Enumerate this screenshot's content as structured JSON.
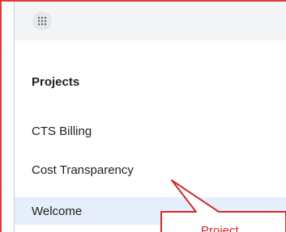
{
  "topbar": {
    "app_launcher_icon": "grid-icon"
  },
  "projects": {
    "heading": "Projects",
    "items": [
      {
        "label": "CTS Billing",
        "active": false
      },
      {
        "label": "Cost Transparency",
        "active": false
      },
      {
        "label": "Welcome",
        "active": true
      }
    ]
  },
  "annotation": {
    "text": "Project",
    "color": "#d22b2b"
  },
  "colors": {
    "highlight_border": "#e03a3a",
    "active_item_bg": "#e6eefb",
    "topbar_bg": "#f4f5f6"
  }
}
